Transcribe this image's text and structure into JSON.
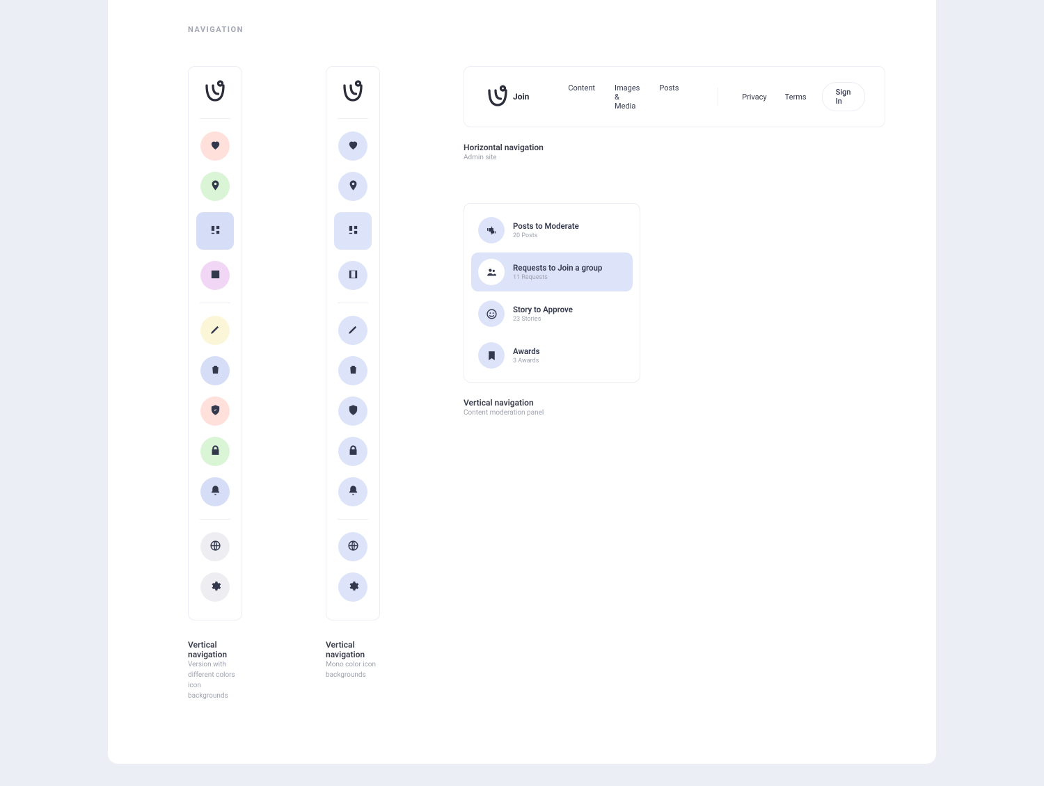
{
  "section_title": "NAVIGATION",
  "captions": {
    "vertical_multi": {
      "title": "Vertical navigation",
      "sub": "Version with different colors icon backgrounds"
    },
    "vertical_mono": {
      "title": "Vertical navigation",
      "sub": "Mono color icon backgrounds"
    },
    "horizontal": {
      "title": "Horizontal navigation",
      "sub": "Admin site"
    },
    "mod_panel": {
      "title": "Vertical navigation",
      "sub": "Content moderation panel"
    }
  },
  "hnav": {
    "brand": "Join",
    "primary_links": [
      "Content",
      "Images & Media",
      "Posts"
    ],
    "secondary_links": [
      "Privacy",
      "Terms"
    ],
    "signin_label": "Sign In"
  },
  "rail_icons": [
    "heart",
    "location",
    "dashboard",
    "film",
    "pencil",
    "trash",
    "shield-check",
    "lock",
    "bell",
    "globe",
    "gear"
  ],
  "mod_panel": {
    "items": [
      {
        "icon": "thumbs",
        "title": "Posts to Moderate",
        "sub": "20 Posts",
        "active": false
      },
      {
        "icon": "group",
        "title": "Requests to Join a group",
        "sub": "11 Requests",
        "active": true
      },
      {
        "icon": "face",
        "title": "Story to Approve",
        "sub": "23 Stories",
        "active": false
      },
      {
        "icon": "bookmark",
        "title": "Awards",
        "sub": "3 Awards",
        "active": false
      }
    ]
  }
}
